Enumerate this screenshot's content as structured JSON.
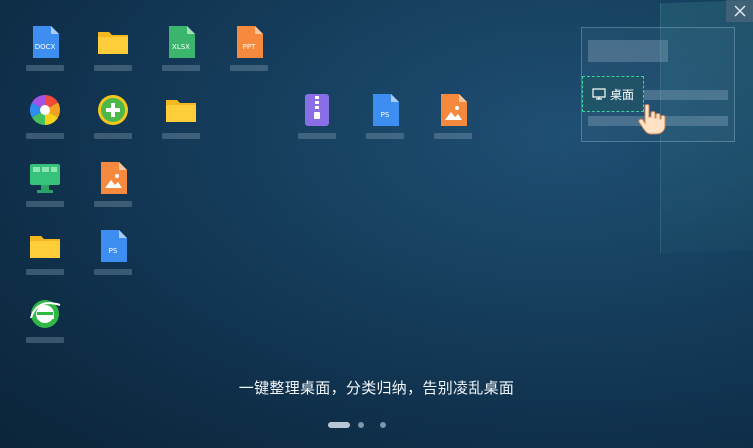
{
  "window": {
    "close_label": "×"
  },
  "caption": "一键整理桌面，分类归纳，告别凌乱桌面",
  "icons": [
    {
      "name": "docx-file-icon",
      "type": "docx",
      "text": "DOCX"
    },
    {
      "name": "folder-icon",
      "type": "folder"
    },
    {
      "name": "xlsx-file-icon",
      "type": "xlsx",
      "text": "XLSX"
    },
    {
      "name": "ppt-file-icon",
      "type": "ppt",
      "text": "PPT"
    },
    {
      "name": "color-wheel-app-icon",
      "type": "wheel"
    },
    {
      "name": "green-plus-app-icon",
      "type": "plus"
    },
    {
      "name": "folder-icon",
      "type": "folder"
    },
    {
      "name": "zip-archive-icon",
      "type": "zip"
    },
    {
      "name": "ps-file-icon",
      "type": "ps",
      "text": "PS"
    },
    {
      "name": "image-file-icon",
      "type": "image"
    },
    {
      "name": "monitor-app-icon",
      "type": "monitor"
    },
    {
      "name": "image-file-icon",
      "type": "image"
    },
    {
      "name": "folder-icon",
      "type": "folder"
    },
    {
      "name": "ps-file-icon",
      "type": "ps",
      "text": "PS"
    },
    {
      "name": "browser-e-icon",
      "type": "browser"
    }
  ],
  "organizer_panel": {
    "desktop_label": "桌面"
  },
  "pagination": {
    "pages": 3,
    "active": 0
  },
  "colors": {
    "accent_dashed": "#38d3a0",
    "folder": "#f5b820",
    "docx": "#3d8ef0",
    "xlsx": "#3bb56b",
    "ppt": "#f5893d",
    "zip": "#8a6ee6"
  }
}
